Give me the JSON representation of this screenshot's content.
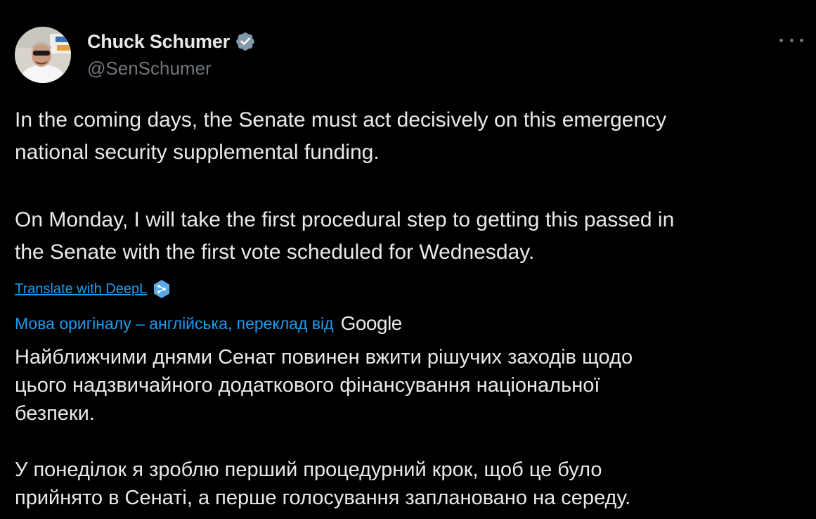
{
  "author": {
    "display_name": "Chuck Schumer",
    "handle": "@SenSchumer",
    "verified": true
  },
  "tweet": {
    "paragraph1_lines": [
      "In the coming days, the Senate must act decisively on this emergency",
      "national security supplemental funding."
    ],
    "paragraph2_lines": [
      "On Monday, I will take the first procedural step to getting this passed in",
      "the Senate with the first vote scheduled for Wednesday."
    ]
  },
  "translate": {
    "deepl_link": "Translate with DeepL",
    "google_attribution": "Мова оригіналу – англійська, переклад від",
    "google_logo": "Google"
  },
  "translation": {
    "paragraph1_lines": [
      "Найближчими днями Сенат повинен вжити рішучих заходів щодо",
      "цього надзвичайного додаткового фінансування національної",
      "безпеки."
    ],
    "paragraph2_lines": [
      "У понеділок я зроблю перший процедурний крок, щоб це було",
      "прийнято в Сенаті, а перше голосування заплановано на середу."
    ]
  },
  "colors": {
    "background": "#000000",
    "text": "#e7e9ea",
    "secondary": "#71767b",
    "link": "#1d9bf0",
    "verified_badge": "#829aab"
  },
  "icons": {
    "verified": "verified-badge-icon",
    "more": "more-options-icon",
    "deepl": "deepl-icon"
  }
}
